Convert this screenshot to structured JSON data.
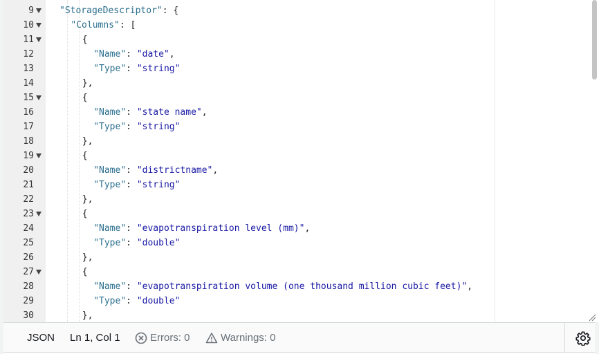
{
  "editor": {
    "lines": [
      {
        "n": "9",
        "fold": true,
        "indent": 0,
        "tokens": [
          [
            "key",
            "\"StorageDescriptor\""
          ],
          [
            "punc",
            ": {"
          ]
        ]
      },
      {
        "n": "10",
        "fold": true,
        "indent": 1,
        "tokens": [
          [
            "key",
            "\"Columns\""
          ],
          [
            "punc",
            ": ["
          ]
        ]
      },
      {
        "n": "11",
        "fold": true,
        "indent": 2,
        "tokens": [
          [
            "punc",
            "{"
          ]
        ]
      },
      {
        "n": "12",
        "fold": false,
        "indent": 3,
        "tokens": [
          [
            "key",
            "\"Name\""
          ],
          [
            "punc",
            ": "
          ],
          [
            "str",
            "\"date\""
          ],
          [
            "punc",
            ","
          ]
        ]
      },
      {
        "n": "13",
        "fold": false,
        "indent": 3,
        "tokens": [
          [
            "key",
            "\"Type\""
          ],
          [
            "punc",
            ": "
          ],
          [
            "str",
            "\"string\""
          ]
        ]
      },
      {
        "n": "14",
        "fold": false,
        "indent": 2,
        "tokens": [
          [
            "punc",
            "},"
          ]
        ]
      },
      {
        "n": "15",
        "fold": true,
        "indent": 2,
        "tokens": [
          [
            "punc",
            "{"
          ]
        ]
      },
      {
        "n": "16",
        "fold": false,
        "indent": 3,
        "tokens": [
          [
            "key",
            "\"Name\""
          ],
          [
            "punc",
            ": "
          ],
          [
            "str",
            "\"state name\""
          ],
          [
            "punc",
            ","
          ]
        ]
      },
      {
        "n": "17",
        "fold": false,
        "indent": 3,
        "tokens": [
          [
            "key",
            "\"Type\""
          ],
          [
            "punc",
            ": "
          ],
          [
            "str",
            "\"string\""
          ]
        ]
      },
      {
        "n": "18",
        "fold": false,
        "indent": 2,
        "tokens": [
          [
            "punc",
            "},"
          ]
        ]
      },
      {
        "n": "19",
        "fold": true,
        "indent": 2,
        "tokens": [
          [
            "punc",
            "{"
          ]
        ]
      },
      {
        "n": "20",
        "fold": false,
        "indent": 3,
        "tokens": [
          [
            "key",
            "\"Name\""
          ],
          [
            "punc",
            ": "
          ],
          [
            "str",
            "\"districtname\""
          ],
          [
            "punc",
            ","
          ]
        ]
      },
      {
        "n": "21",
        "fold": false,
        "indent": 3,
        "tokens": [
          [
            "key",
            "\"Type\""
          ],
          [
            "punc",
            ": "
          ],
          [
            "str",
            "\"string\""
          ]
        ]
      },
      {
        "n": "22",
        "fold": false,
        "indent": 2,
        "tokens": [
          [
            "punc",
            "},"
          ]
        ]
      },
      {
        "n": "23",
        "fold": true,
        "indent": 2,
        "tokens": [
          [
            "punc",
            "{"
          ]
        ]
      },
      {
        "n": "24",
        "fold": false,
        "indent": 3,
        "tokens": [
          [
            "key",
            "\"Name\""
          ],
          [
            "punc",
            ": "
          ],
          [
            "str",
            "\"evapotranspiration level (mm)\""
          ],
          [
            "punc",
            ","
          ]
        ]
      },
      {
        "n": "25",
        "fold": false,
        "indent": 3,
        "tokens": [
          [
            "key",
            "\"Type\""
          ],
          [
            "punc",
            ": "
          ],
          [
            "str",
            "\"double\""
          ]
        ]
      },
      {
        "n": "26",
        "fold": false,
        "indent": 2,
        "tokens": [
          [
            "punc",
            "},"
          ]
        ]
      },
      {
        "n": "27",
        "fold": true,
        "indent": 2,
        "tokens": [
          [
            "punc",
            "{"
          ]
        ]
      },
      {
        "n": "28",
        "fold": false,
        "indent": 3,
        "tokens": [
          [
            "key",
            "\"Name\""
          ],
          [
            "punc",
            ": "
          ],
          [
            "str",
            "\"evapotranspiration volume (one thousand million cubic feet)\""
          ],
          [
            "punc",
            ","
          ]
        ]
      },
      {
        "n": "29",
        "fold": false,
        "indent": 3,
        "tokens": [
          [
            "key",
            "\"Type\""
          ],
          [
            "punc",
            ": "
          ],
          [
            "str",
            "\"double\""
          ]
        ]
      },
      {
        "n": "30",
        "fold": false,
        "indent": 2,
        "tokens": [
          [
            "punc",
            "},"
          ]
        ]
      }
    ]
  },
  "status": {
    "language": "JSON",
    "cursor": "Ln 1, Col 1",
    "errors": "Errors: 0",
    "warnings": "Warnings: 0"
  },
  "icons": {
    "fold": "triangle-down-icon",
    "errors": "x-circle-icon",
    "warnings": "warning-triangle-icon",
    "settings": "gear-icon",
    "resize": "resize-handle-icon"
  },
  "colors": {
    "gutter": "#f0f0f0",
    "string": "#1a1aa6",
    "key": "#2b6f8e",
    "statusbar": "#fafafa",
    "muted": "#687078"
  }
}
